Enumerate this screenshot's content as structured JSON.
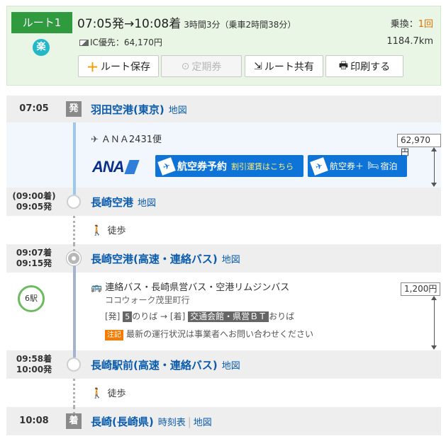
{
  "header": {
    "route_label": "ルート1",
    "raku": "楽",
    "dep_arr": "07:05発→10:08着",
    "duration": "3時間3分（乗車2時間38分）",
    "ic_label": "IC優先：64,170円",
    "transfer_label": "乗換：",
    "transfer_count": "1回",
    "distance": "1184.7km",
    "buttons": {
      "save": "ルート保存",
      "teiki": "定期券",
      "share": "ルート共有",
      "print": "印刷する"
    }
  },
  "stations": [
    {
      "time": "07:05",
      "badge": "発",
      "name": "羽田空港(東京)",
      "links": [
        "地図"
      ]
    },
    {
      "time_lines": [
        "(09:00着)",
        "09:05発"
      ],
      "name": "長崎空港",
      "links": [
        "地図"
      ]
    },
    {
      "time_lines": [
        "09:07着",
        "09:15発"
      ],
      "name": "長崎空港(高速・連絡バス)",
      "links": [
        "地図"
      ]
    },
    {
      "time_lines": [
        "09:58着",
        "10:00発"
      ],
      "name": "長崎駅前(高速・連絡バス)",
      "links": [
        "地図"
      ]
    },
    {
      "time": "10:08",
      "badge": "着",
      "name": "長崎(長崎県)",
      "links": [
        "時刻表",
        "地図"
      ]
    }
  ],
  "segments": {
    "flight": {
      "label": "ＡＮＡ2431便",
      "fare": "62,970円",
      "logo_text": "ANA",
      "banner1_main": "航空券予約",
      "banner1_sub": "割引運賃はこちら",
      "banner2_text": "航空券＋",
      "banner2_hotel": "宿泊"
    },
    "walk1": {
      "label": "徒歩"
    },
    "bus": {
      "label": "連絡バス・長崎県営バス・空港リムジンバス",
      "via": "ココウォーク茂里町行",
      "stops": "6駅",
      "board_dep": "[発]",
      "board_num": "5",
      "board_mid": "のりば → [着]",
      "board_dest": "交通会館・県営ＢＴ",
      "board_end": "おりば",
      "note_tag": "注記",
      "note": "最新の運行状況は事業者へお問い合わせください",
      "fare": "1,200円"
    },
    "walk2": {
      "label": "徒歩"
    }
  },
  "colors": {
    "route_green": "#2f9a3e",
    "link_blue": "#0b5cad",
    "ana_blue": "#0e74d8",
    "transfer_orange": "#e07000"
  }
}
